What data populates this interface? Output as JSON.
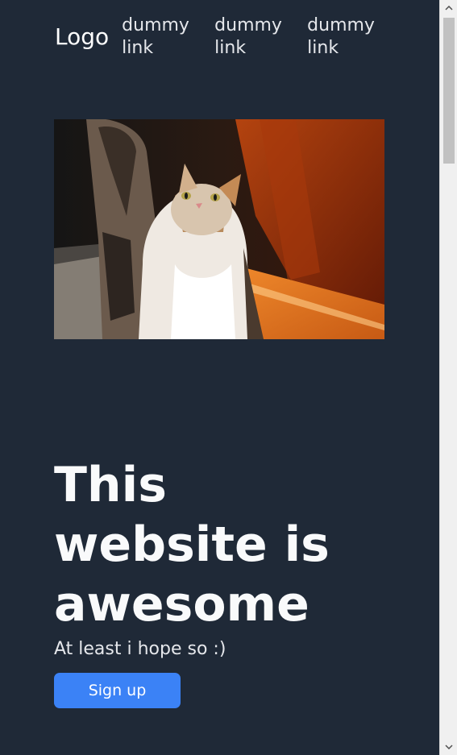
{
  "navbar": {
    "logo": "Logo",
    "links": [
      "dummy link",
      "dummy link",
      "dummy link"
    ]
  },
  "hero": {
    "image_subject": "cat-photo",
    "title": "This website is awesome",
    "subtitle": "At least i hope so :)",
    "cta_label": "Sign up"
  },
  "colors": {
    "background": "#1f2937",
    "accent": "#3b82f6",
    "text": "#f9fafb"
  }
}
